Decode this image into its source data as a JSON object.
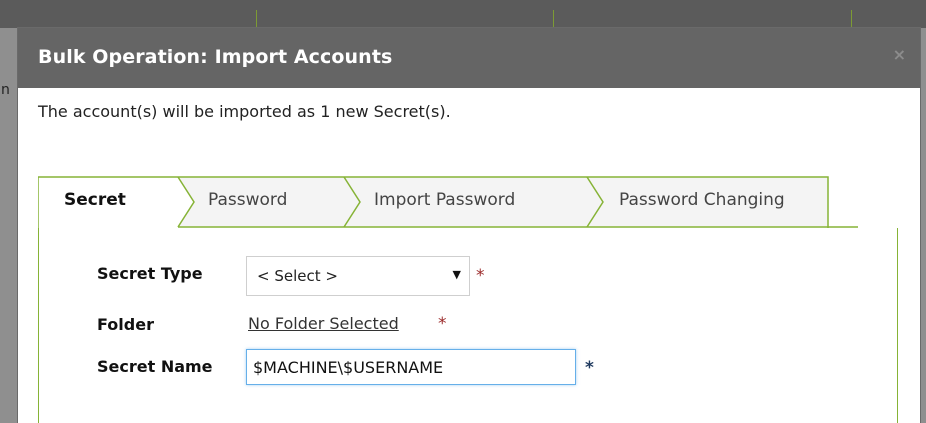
{
  "background": {
    "partial_letter": "n"
  },
  "modal": {
    "title": "Bulk Operation: Import Accounts",
    "close_glyph": "×",
    "description": "The account(s) will be imported as 1 new Secret(s)."
  },
  "tabs": [
    {
      "label": "Secret",
      "active": true
    },
    {
      "label": "Password",
      "active": false
    },
    {
      "label": "Import Password",
      "active": false
    },
    {
      "label": "Password Changing",
      "active": false
    }
  ],
  "form": {
    "secret_type": {
      "label": "Secret Type",
      "value": "< Select >",
      "arrow": "▼",
      "required_mark": "*"
    },
    "folder": {
      "label": "Folder",
      "link_text": "No Folder Selected",
      "required_mark": "*"
    },
    "secret_name": {
      "label": "Secret Name",
      "value": "$MACHINE\\$USERNAME",
      "required_mark": "*"
    }
  },
  "colors": {
    "header_bg": "#656565",
    "tab_border": "#86b336",
    "required": "#9b2a2a",
    "input_focus": "#66afe9"
  }
}
